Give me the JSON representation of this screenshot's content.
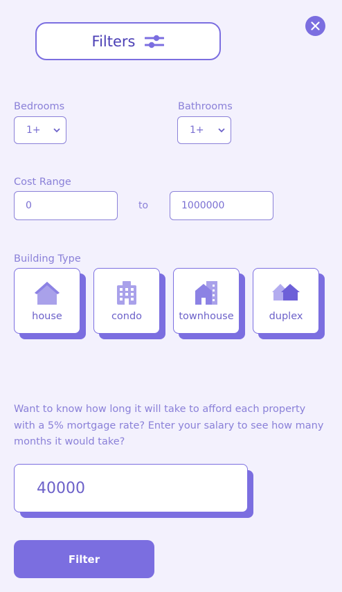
{
  "header": {
    "title": "Filters",
    "icon": "sliders-icon"
  },
  "close": {
    "icon": "close-icon"
  },
  "bedrooms": {
    "label": "Bedrooms",
    "value": "1+"
  },
  "bathrooms": {
    "label": "Bathrooms",
    "value": "1+"
  },
  "cost_range": {
    "label": "Cost Range",
    "min": "0",
    "separator": "to",
    "max": "1000000"
  },
  "building_type": {
    "label": "Building Type",
    "items": [
      {
        "label": "house",
        "icon": "house-icon"
      },
      {
        "label": "condo",
        "icon": "condo-icon"
      },
      {
        "label": "townhouse",
        "icon": "townhouse-icon"
      },
      {
        "label": "duplex",
        "icon": "duplex-icon"
      }
    ]
  },
  "mortgage_info": "Want to know how long it will take to afford each property with a 5% mortgage rate? Enter your salary to see how many months it would take?",
  "salary": {
    "value": "40000"
  },
  "filter_button": {
    "label": "Filter"
  },
  "colors": {
    "accent": "#7b6ee0",
    "background": "#f3f1fd",
    "text": "#8a80d8"
  }
}
